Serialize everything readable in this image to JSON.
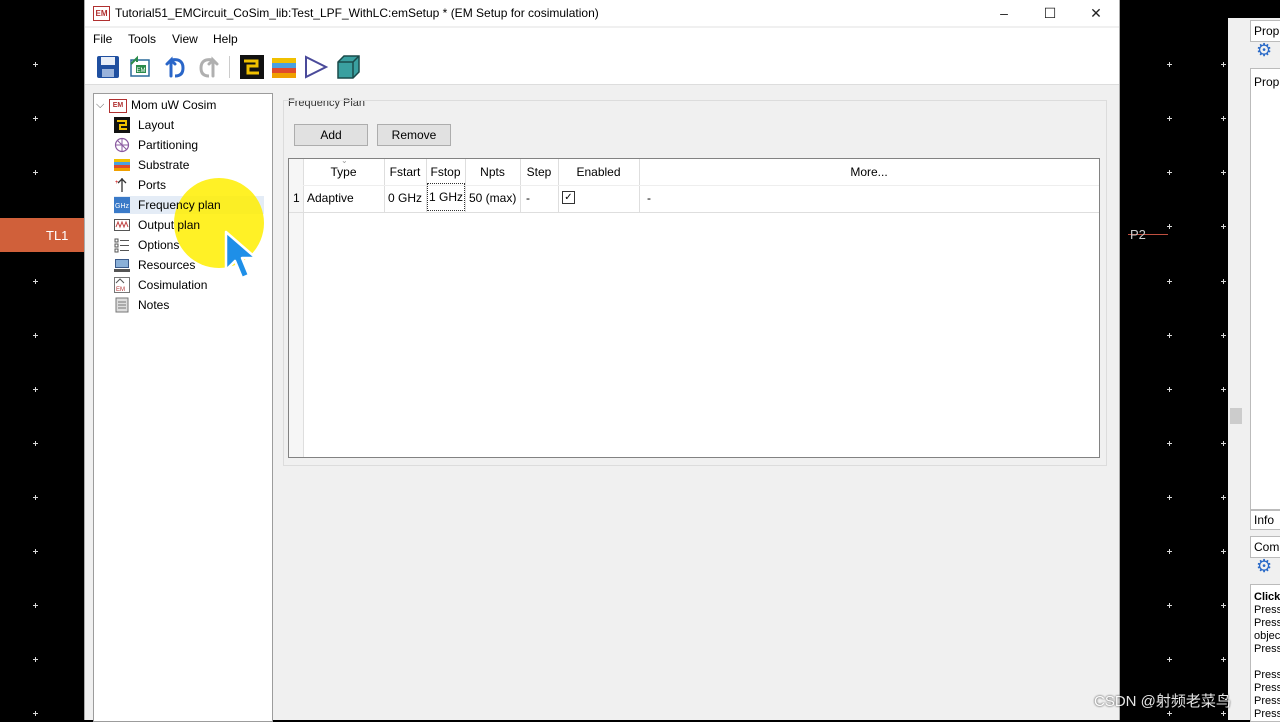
{
  "window": {
    "title": "Tutorial51_EMCircuit_CoSim_lib:Test_LPF_WithLC:emSetup * (EM Setup for cosimulation)",
    "icon_text": "EM",
    "minimize": "–",
    "maximize": "☐",
    "close": "✕"
  },
  "menu": [
    "File",
    "Tools",
    "View",
    "Help"
  ],
  "toolbar": [
    "save-icon",
    "em-export-icon",
    "undo-icon",
    "redo-icon",
    "layout-icon",
    "substrate-icon",
    "simulate-icon",
    "3d-view-icon"
  ],
  "tree": {
    "root": "Mom uW Cosim",
    "root_icon": "EM",
    "items": [
      {
        "label": "Layout",
        "icon": "layout-icon"
      },
      {
        "label": "Partitioning",
        "icon": "partitioning-icon"
      },
      {
        "label": "Substrate",
        "icon": "substrate-icon"
      },
      {
        "label": "Ports",
        "icon": "ports-icon"
      },
      {
        "label": "Frequency plan",
        "icon": "frequency-icon",
        "selected": true
      },
      {
        "label": "Output plan",
        "icon": "output-icon"
      },
      {
        "label": "Options",
        "icon": "options-icon"
      },
      {
        "label": "Resources",
        "icon": "resources-icon"
      },
      {
        "label": "Cosimulation",
        "icon": "cosimulation-icon"
      },
      {
        "label": "Notes",
        "icon": "notes-icon"
      }
    ]
  },
  "frequency_plan": {
    "group_title": "Frequency Plan",
    "add_label": "Add",
    "remove_label": "Remove",
    "columns": [
      "Type",
      "Fstart",
      "Fstop",
      "Npts",
      "Step",
      "Enabled",
      "More..."
    ],
    "rows": [
      {
        "index": "1",
        "type": "Adaptive",
        "fstart": "0 GHz",
        "fstop": "1 GHz",
        "npts": "50 (max)",
        "step": "-",
        "enabled": true,
        "more": "-"
      }
    ]
  },
  "schematic": {
    "left_component": "TL1",
    "right_component": "P2"
  },
  "dock": {
    "props_tab": "Prop",
    "props_label": "Prop",
    "info_tab": "Info",
    "com_tab": "Com",
    "log_lines": [
      "Click",
      "Press",
      "Press",
      "objec",
      "Press",
      "Press",
      "Press",
      "Press",
      "Press"
    ]
  },
  "watermark": "CSDN @射频老菜鸟",
  "colors": {
    "component_fill": "#d0603a",
    "highlight": "#ffee00",
    "cursor": "#1e8fe8"
  }
}
